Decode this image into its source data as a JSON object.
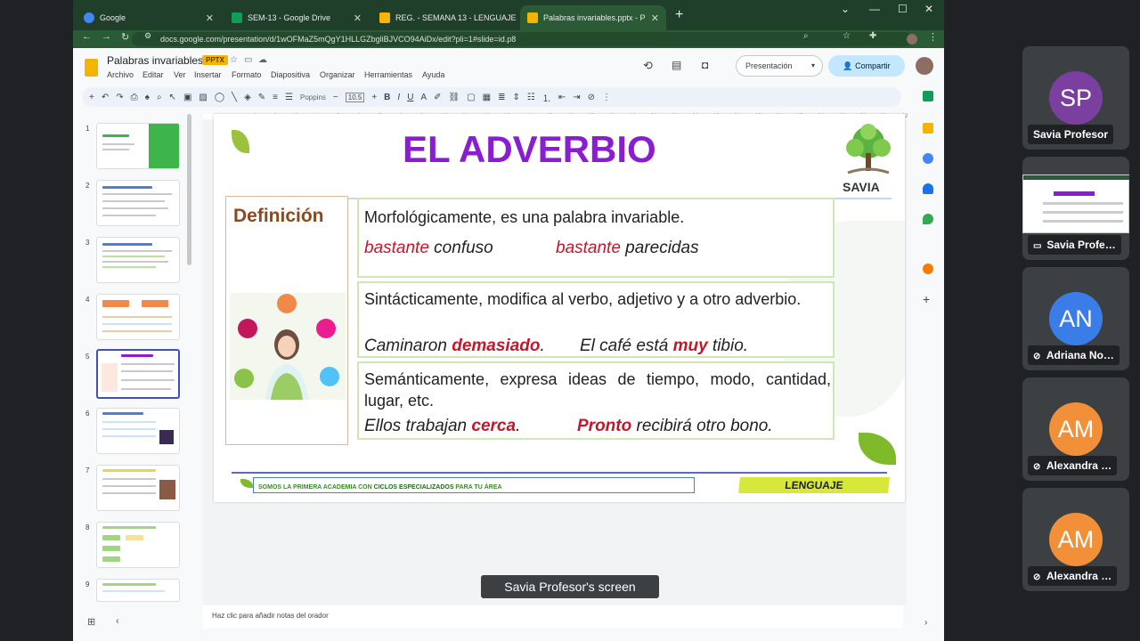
{
  "browser": {
    "tabs": [
      {
        "label": "Google",
        "active": false,
        "favicon_color": "#4285f4"
      },
      {
        "label": "SEM-13 - Google Drive",
        "active": false,
        "favicon_color": "#0f9d58"
      },
      {
        "label": "REG. - SEMANA 13 - LENGUAJE",
        "active": false,
        "favicon_color": "#f4b400"
      },
      {
        "label": "Palabras invariables.pptx - Presen",
        "active": true,
        "favicon_color": "#f4b400"
      }
    ],
    "url": "docs.google.com/presentation/d/1wOFMaZ5mQgY1HLLGZbgliBJVCO94AiDx/edit?pli=1#slide=id.p8"
  },
  "app": {
    "doc_title": "Palabras invariables",
    "badge": "PPTX",
    "menus": [
      "Archivo",
      "Editar",
      "Ver",
      "Insertar",
      "Formato",
      "Diapositiva",
      "Organizar",
      "Herramientas",
      "Ayuda"
    ],
    "present_label": "Presentación",
    "share_label": "Compartir",
    "font_name": "Poppins",
    "font_size": "10.5",
    "notes_placeholder": "Haz clic para añadir notas del orador",
    "ruler_numbers": [
      "1",
      "2",
      "3",
      "4",
      "5",
      "6",
      "7",
      "8",
      "9",
      "10",
      "11",
      "12",
      "13",
      "14",
      "15",
      "16",
      "17",
      "18",
      "19",
      "20",
      "21",
      "22",
      "23",
      "24",
      "25",
      "26",
      "27",
      "28",
      "29",
      "30",
      "31",
      "32",
      "33"
    ],
    "slide_numbers": [
      "1",
      "2",
      "3",
      "4",
      "5",
      "6",
      "7",
      "8",
      "9"
    ],
    "selected_slide": 5
  },
  "slide": {
    "title": "EL ADVERBIO",
    "definition_label": "Definición",
    "card1": {
      "text": "Morfológicamente, es una palabra invariable.",
      "ex1_highlight": "bastante",
      "ex1_rest": " confuso",
      "ex2_highlight": "bastante",
      "ex2_rest": " parecidas"
    },
    "card2": {
      "text": "Sintácticamente, modifica al verbo, adjetivo y a otro adverbio.",
      "ex1_pre": "Caminaron ",
      "ex1_highlight": "demasiado",
      "ex1_post": ".",
      "ex2_pre": "El café está ",
      "ex2_highlight": "muy",
      "ex2_post": " tibio."
    },
    "card3": {
      "text": "Semánticamente, expresa ideas de tiempo, modo, cantidad, lugar, etc.",
      "ex1_pre": "Ellos trabajan ",
      "ex1_highlight": "cerca",
      "ex1_post": ".",
      "ex2_highlight": "Pronto",
      "ex2_post": " recibirá otro bono."
    },
    "footer_pre": "SOMOS LA PRIMERA ACADEMIA CON ",
    "footer_bold": "CICLOS ESPECIALIZADOS",
    "footer_post": " PARA TU ÁREA",
    "subject_tag": "LENGUAJE",
    "brand": "SAVIA"
  },
  "meet": {
    "caption": "Savia Profesor's screen",
    "participants": [
      {
        "initials": "SP",
        "name": "Savia Profesor",
        "color": "#7b3fa0",
        "muted": false,
        "presenting": false
      },
      {
        "initials": "",
        "name": "Savia Profe…",
        "color": "#ffffff",
        "muted": false,
        "presenting": true
      },
      {
        "initials": "AN",
        "name": "Adriana No…",
        "color": "#3b7de8",
        "muted": true,
        "presenting": false
      },
      {
        "initials": "AM",
        "name": "Alexandra …",
        "color": "#f2903a",
        "muted": true,
        "presenting": false
      },
      {
        "initials": "AM",
        "name": "Alexandra …",
        "color": "#f2903a",
        "muted": true,
        "presenting": false
      }
    ]
  },
  "colors": {
    "title_purple": "#8a1dd1",
    "highlight_red": "#c2182b",
    "chrome_green": "#1f3f2a",
    "lenguaje_yellow": "#d7e83a"
  }
}
